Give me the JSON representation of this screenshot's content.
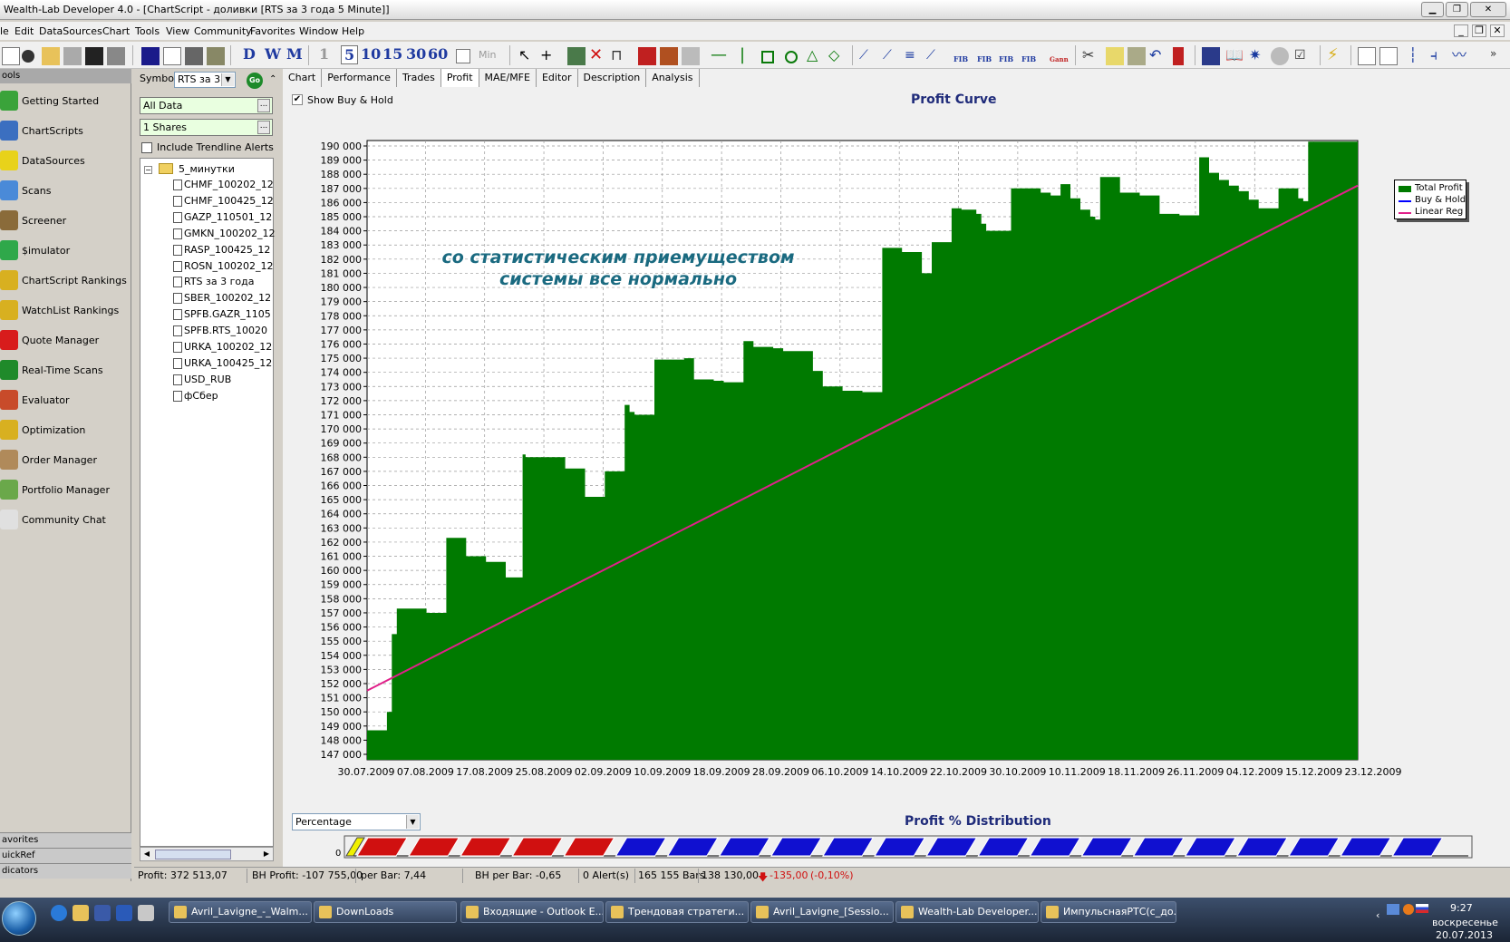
{
  "window": {
    "title": "Wealth-Lab Developer 4.0 - [ChartScript - доливки [RTS за 3 года 5 Minute]]"
  },
  "menu": [
    "le",
    "Edit",
    "DataSources",
    "Chart",
    "Tools",
    "View",
    "Community",
    "Favorites",
    "Window",
    "Help"
  ],
  "toolbar": {
    "scale_buttons": [
      "D",
      "W",
      "M"
    ],
    "interval_buttons": [
      "1",
      "5",
      "10",
      "15",
      "30",
      "60"
    ],
    "min_label": "Min",
    "fib_labels": [
      "FIB",
      "FIB",
      "FIB",
      "FIB"
    ],
    "gann_label": "Gann"
  },
  "tools": {
    "header": "ools",
    "items": [
      {
        "label": "Getting Started",
        "icon": "getting-started-icon",
        "color": "#3aa33a"
      },
      {
        "label": "ChartScripts",
        "icon": "chartscripts-icon",
        "color": "#3b6fc0"
      },
      {
        "label": "DataSources",
        "icon": "datasources-icon",
        "color": "#e8d21a"
      },
      {
        "label": "Scans",
        "icon": "scans-icon",
        "color": "#4a8ad8"
      },
      {
        "label": "Screener",
        "icon": "screener-icon",
        "color": "#8a6b3a"
      },
      {
        "label": "$imulator",
        "icon": "simulator-icon",
        "color": "#2fa84a"
      },
      {
        "label": "ChartScript Rankings",
        "icon": "trophy-icon",
        "color": "#d8b020"
      },
      {
        "label": "WatchList Rankings",
        "icon": "trophy-icon",
        "color": "#d8b020"
      },
      {
        "label": "Quote Manager",
        "icon": "quote-manager-icon",
        "color": "#d81c1c"
      },
      {
        "label": "Real-Time Scans",
        "icon": "real-time-scans-icon",
        "color": "#1f8a2a"
      },
      {
        "label": "Evaluator",
        "icon": "evaluator-icon",
        "color": "#c84b2a"
      },
      {
        "label": "Optimization",
        "icon": "optimization-icon",
        "color": "#d8b020"
      },
      {
        "label": "Order Manager",
        "icon": "order-manager-icon",
        "color": "#b08a5a"
      },
      {
        "label": "Portfolio Manager",
        "icon": "portfolio-manager-icon",
        "color": "#6aa84a"
      },
      {
        "label": "Community Chat",
        "icon": "chat-icon",
        "color": "#e0e0e0"
      }
    ],
    "bottom_tabs": [
      "avorites",
      "uickRef",
      "dicators"
    ]
  },
  "symbol_panel": {
    "symbol_label": "Symbol",
    "symbol_value": "RTS за 3",
    "go_label": "Go",
    "data_range": "All Data",
    "position_size": "1 Shares",
    "include_trendline": "Include Trendline Alerts",
    "folder": "5_минутки",
    "files": [
      "CHMF_100202_12",
      "CHMF_100425_12",
      "GAZP_110501_12",
      "GMKN_100202_12",
      "RASP_100425_12",
      "ROSN_100202_12",
      "RTS за 3 года",
      "SBER_100202_12",
      "SPFB.GAZR_1105",
      "SPFB.RTS_10020",
      "URKA_100202_12",
      "URKA_100425_12",
      "USD_RUB",
      "фСбер"
    ]
  },
  "tabs": [
    "Chart",
    "Performance",
    "Trades",
    "Profit",
    "MAE/MFE",
    "Editor",
    "Description",
    "Analysis"
  ],
  "active_tab": "Profit",
  "show_buy_hold": "Show Buy & Hold",
  "annotation": {
    "line1": "со статистическим приемуществом",
    "line2": "системы все нормально"
  },
  "chart_data": {
    "type": "area",
    "title": "Profit Curve",
    "ylim": [
      147000,
      190000
    ],
    "y_ticks": [
      "147 000",
      "148 000",
      "149 000",
      "150 000",
      "151 000",
      "152 000",
      "153 000",
      "154 000",
      "155 000",
      "156 000",
      "157 000",
      "158 000",
      "159 000",
      "160 000",
      "161 000",
      "162 000",
      "163 000",
      "164 000",
      "165 000",
      "166 000",
      "167 000",
      "168 000",
      "169 000",
      "170 000",
      "171 000",
      "172 000",
      "173 000",
      "174 000",
      "175 000",
      "176 000",
      "177 000",
      "178 000",
      "179 000",
      "180 000",
      "181 000",
      "182 000",
      "183 000",
      "184 000",
      "185 000",
      "186 000",
      "187 000",
      "188 000",
      "189 000",
      "190 000"
    ],
    "x_ticks": [
      "30.07.2009",
      "07.08.2009",
      "17.08.2009",
      "25.08.2009",
      "02.09.2009",
      "10.09.2009",
      "18.09.2009",
      "28.09.2009",
      "06.10.2009",
      "14.10.2009",
      "22.10.2009",
      "30.10.2009",
      "10.11.2009",
      "18.11.2009",
      "26.11.2009",
      "04.12.2009",
      "15.12.2009",
      "23.12.2009"
    ],
    "legend": [
      "Total Profit",
      "Buy & Hold",
      "Linear Reg"
    ],
    "legend_colors": [
      "#007a00",
      "#0000ff",
      "#e0208a"
    ],
    "legend_position": "top-right",
    "grid": true,
    "series": [
      {
        "name": "Total Profit",
        "x_pos": [
          0,
          0.015,
          0.02,
          0.025,
          0.03,
          0.04,
          0.06,
          0.078,
          0.08,
          0.1,
          0.12,
          0.14,
          0.155,
          0.157,
          0.16,
          0.2,
          0.22,
          0.24,
          0.26,
          0.265,
          0.27,
          0.29,
          0.31,
          0.32,
          0.33,
          0.35,
          0.36,
          0.38,
          0.39,
          0.41,
          0.42,
          0.45,
          0.46,
          0.48,
          0.5,
          0.52,
          0.54,
          0.56,
          0.57,
          0.59,
          0.6,
          0.615,
          0.62,
          0.625,
          0.65,
          0.68,
          0.69,
          0.7,
          0.71,
          0.72,
          0.73,
          0.735,
          0.74,
          0.76,
          0.78,
          0.8,
          0.82,
          0.84,
          0.85,
          0.86,
          0.87,
          0.88,
          0.89,
          0.9,
          0.92,
          0.94,
          0.945,
          0.95,
          0.96,
          0.97,
          1.0
        ],
        "values": [
          148700,
          148700,
          150000,
          155500,
          157300,
          157300,
          157000,
          157000,
          162300,
          161000,
          160600,
          159500,
          159500,
          168200,
          168000,
          167200,
          165200,
          167000,
          171700,
          171200,
          171000,
          174900,
          174900,
          175000,
          173500,
          173400,
          173300,
          176200,
          175800,
          175700,
          175500,
          174100,
          173000,
          172700,
          172600,
          182800,
          182500,
          181000,
          183200,
          185600,
          185500,
          185200,
          184500,
          184000,
          187000,
          186700,
          186500,
          187300,
          186300,
          185500,
          185000,
          184800,
          187800,
          186700,
          186500,
          185200,
          185100,
          189200,
          188100,
          187600,
          187200,
          186800,
          186200,
          185600,
          187000,
          186300,
          186100,
          190300,
          190300,
          190300,
          190300
        ]
      },
      {
        "name": "Linear Reg",
        "x_pos": [
          0,
          1
        ],
        "values": [
          151500,
          187200
        ]
      }
    ]
  },
  "distribution": {
    "mode": "Percentage",
    "title": "Profit % Distribution",
    "zero_label": "0",
    "red_bars": 5,
    "blue_bars": 16
  },
  "status": {
    "profit": "Profit: 372 513,07",
    "bh_profit": "BH Profit: -107 755,00",
    "per_bar": "per Bar: 7,44",
    "bh_per_bar": "BH per Bar: -0,65",
    "alerts": "0 Alert(s)",
    "bars": "165 155 Bars",
    "price": "138 130,00",
    "change": "-135,00",
    "change_pct": "(-0,10%)"
  },
  "taskbar": {
    "buttons": [
      "Avril_Lavigne_-_Walm...",
      "DownLoads",
      "Входящие - Outlook E...",
      "Трендовая стратеги...",
      "Avril_Lavigne_[Sessio...",
      "Wealth-Lab Developer...",
      "ИмпульснаяРТС(с_до..."
    ],
    "time": "9:27",
    "day": "воскресенье",
    "date": "20.07.2013"
  }
}
